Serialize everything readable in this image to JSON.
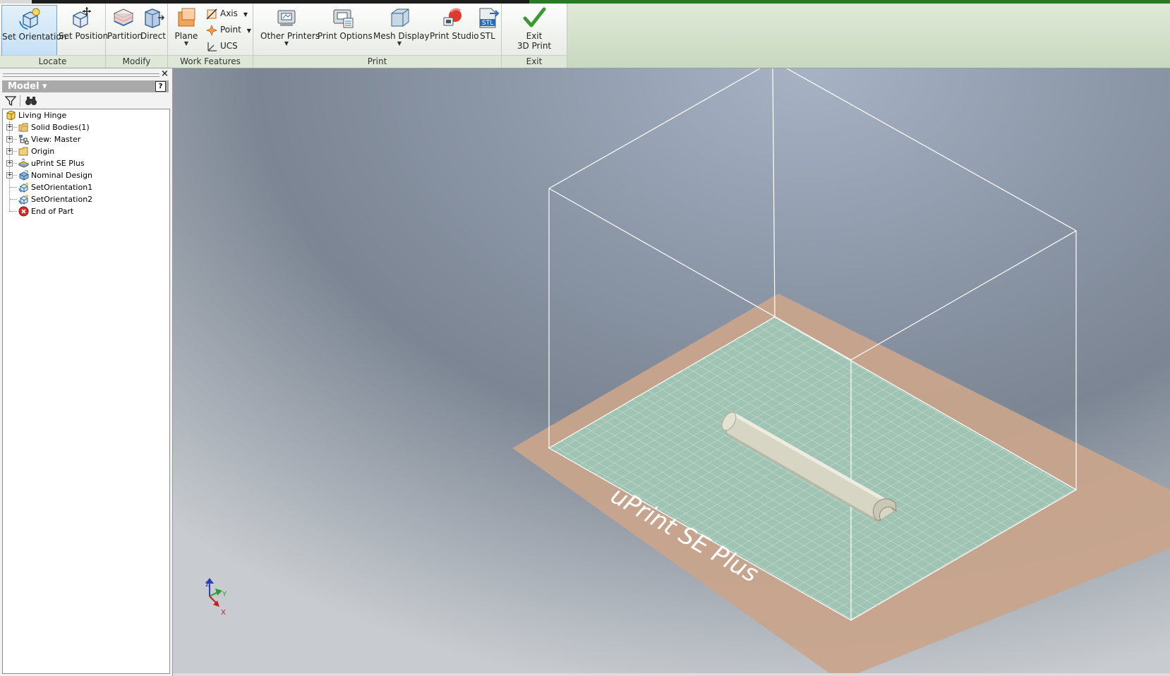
{
  "ribbon": {
    "groups": {
      "locate": "Locate",
      "modify": "Modify",
      "work_features": "Work Features",
      "print": "Print",
      "exit": "Exit"
    },
    "buttons": {
      "set_orientation": "Set Orientation",
      "set_position": "Set Position",
      "partition": "Partition",
      "direct": "Direct",
      "plane": "Plane",
      "axis": "Axis",
      "point": "Point",
      "ucs": "UCS",
      "other_printers": "Other Printers",
      "print_options": "Print Options",
      "mesh_display": "Mesh Display",
      "print_studio": "Print Studio",
      "stl": "STL",
      "exit_line1": "Exit",
      "exit_line2": "3D Print"
    },
    "stl_icon_text": "STL"
  },
  "browser": {
    "title": "Model",
    "help_glyph": "?",
    "close_glyph": "×",
    "tree": [
      {
        "label": "Living Hinge",
        "icon": "part-icon",
        "expandable": false
      },
      {
        "label": "Solid Bodies(1)",
        "icon": "folder-icon",
        "expandable": true
      },
      {
        "label": "View: Master",
        "icon": "view-rep-icon",
        "expandable": true
      },
      {
        "label": "Origin",
        "icon": "folder-icon",
        "expandable": true
      },
      {
        "label": "uPrint SE Plus",
        "icon": "printer-icon",
        "expandable": true
      },
      {
        "label": "Nominal Design",
        "icon": "design-icon",
        "expandable": true
      },
      {
        "label": "SetOrientation1",
        "icon": "orientation-icon",
        "expandable": false
      },
      {
        "label": "SetOrientation2",
        "icon": "orientation-icon",
        "expandable": false
      },
      {
        "label": "End of Part",
        "icon": "end-of-part-icon",
        "expandable": false
      }
    ]
  },
  "viewport": {
    "printer_label": "uPrint SE Plus",
    "triad": {
      "x": "X",
      "y": "Y",
      "z": "Z"
    },
    "colors": {
      "bed_border": "#c8a48c",
      "bed_grid": "#9fc4b4",
      "part": "#d7d5c4",
      "build_volume": "#ffffff"
    }
  }
}
